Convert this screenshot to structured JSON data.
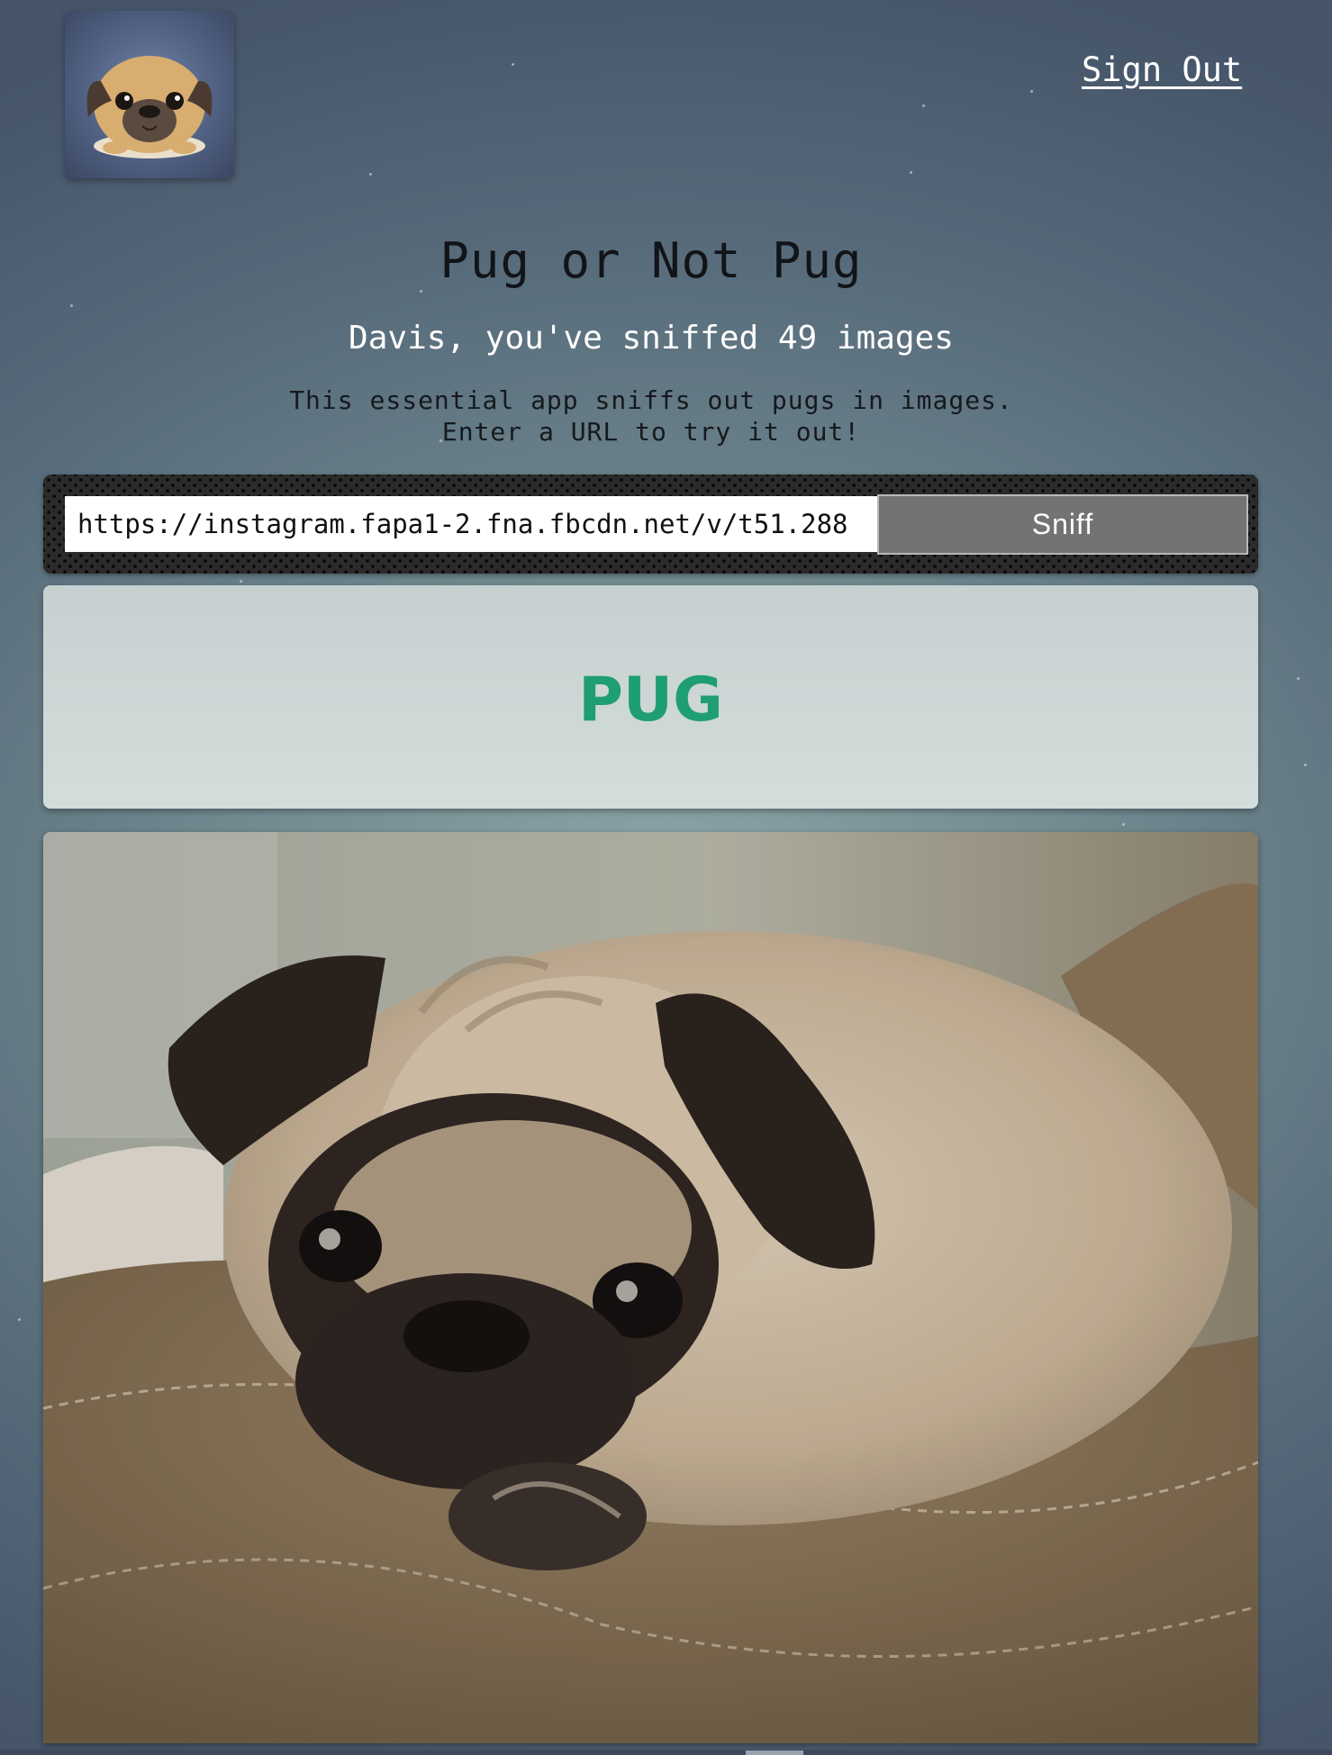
{
  "header": {
    "logo_icon": "pug-cartoon-logo",
    "signout_label": "Sign Out"
  },
  "main": {
    "title": "Pug or Not Pug",
    "greeting": "Davis, you've sniffed 49 images",
    "description_line1": "This essential app sniffs out pugs in images.",
    "description_line2": "Enter a URL to try it out!"
  },
  "form": {
    "url_value": "https://instagram.fapa1-2.fna.fbcdn.net/v/t51.288",
    "sniff_label": "Sniff"
  },
  "result": {
    "label": "PUG",
    "color": "#1f9e72"
  },
  "photo": {
    "subject": "pug-resting-on-cushion-photo"
  }
}
